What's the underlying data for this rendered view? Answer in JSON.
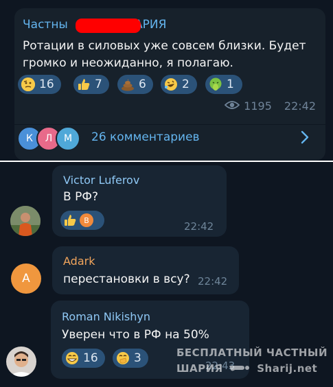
{
  "post": {
    "author": "Частны",
    "author_suffix": "ШАРИЯ",
    "text": "Ротации в силовых уже совсем близки. Будет громко и неожиданно, я полагаю.",
    "reactions": [
      {
        "icon": "thinking-face-icon",
        "count": "16"
      },
      {
        "icon": "thumbs-up-icon",
        "count": "7"
      },
      {
        "icon": "pile-of-poo-icon",
        "count": "6"
      },
      {
        "icon": "rofl-face-icon",
        "count": "2"
      },
      {
        "icon": "vomiting-face-icon",
        "count": "1"
      }
    ],
    "views": "1195",
    "time": "22:42",
    "commenter_initials": [
      "К",
      "Л",
      "М"
    ],
    "comments_label": "26 комментариев"
  },
  "comments": [
    {
      "name": "Victor Luferov",
      "text": "В РФ?",
      "reaction_icons": [
        "thumbs-up-icon"
      ],
      "reaction_user_initial": "В",
      "time": "22:42"
    },
    {
      "name": "Adark",
      "avatar_initial": "A",
      "text": "перестановки в всу?",
      "time": "22:42"
    },
    {
      "name": "Roman Nikishyn",
      "text": "Уверен что в РФ на 50%",
      "reactions": [
        {
          "icon": "grinning-face-icon",
          "count": "16"
        },
        {
          "icon": "face-with-hand-over-mouth-icon",
          "count": "3"
        }
      ],
      "time": "22:43"
    }
  ],
  "watermark": {
    "line1": "БЕСПЛАТНЫЙ ЧАСТНЫЙ",
    "line2_left": "ШАРИЯ",
    "line2_right": "Sharij.net"
  },
  "colors": {
    "background": "#0e1621",
    "bubble": "#17212b",
    "reaction_bg": "#2b5278",
    "link": "#64b5ef",
    "redaction": "#ff0000"
  }
}
